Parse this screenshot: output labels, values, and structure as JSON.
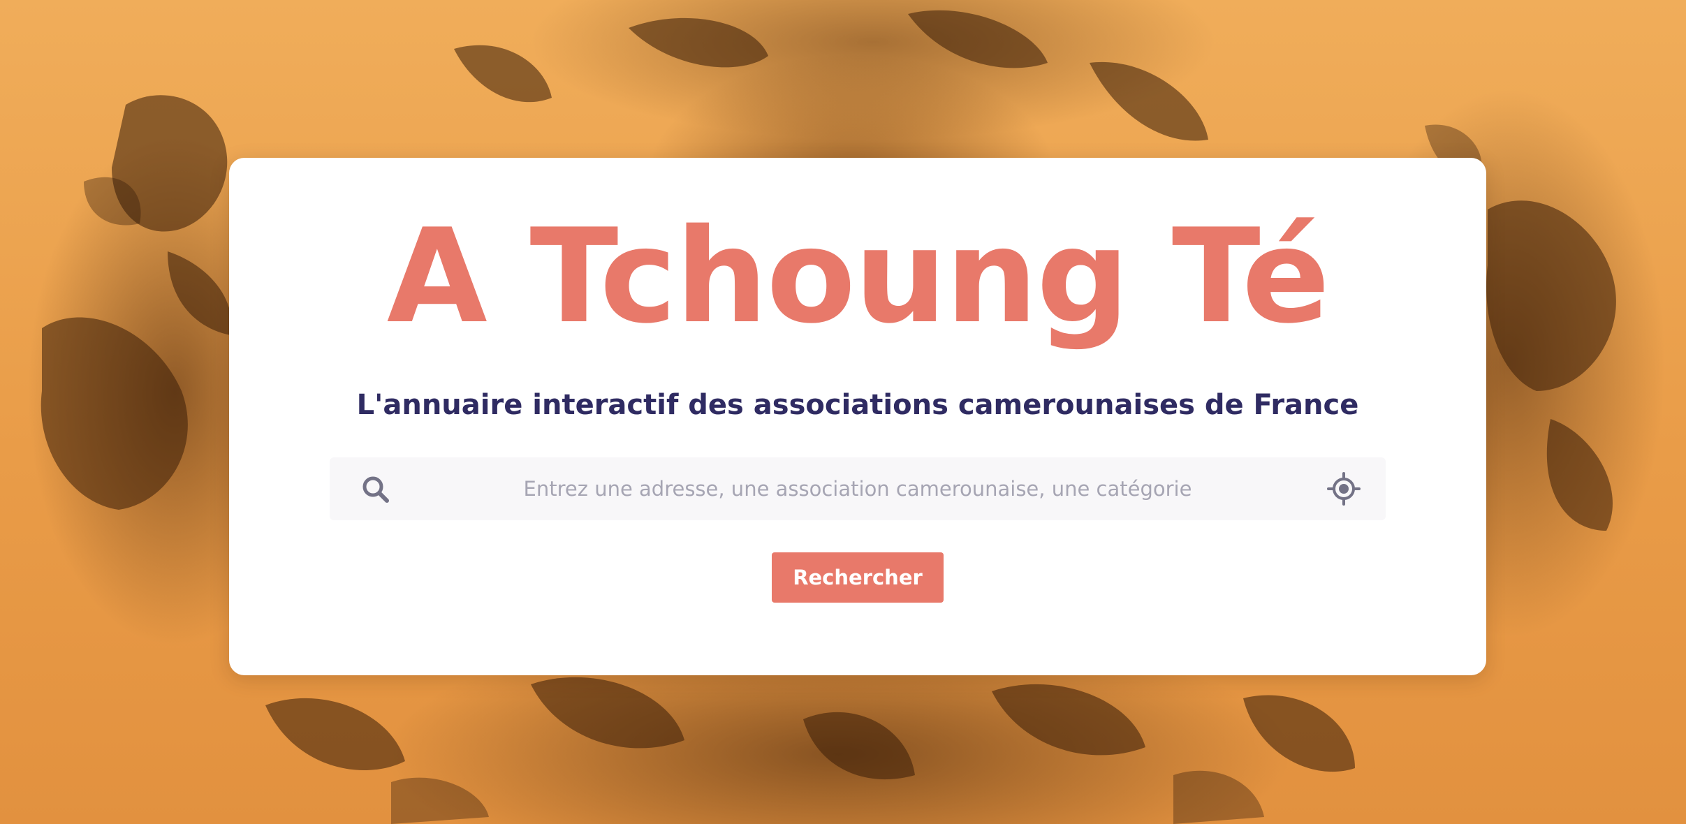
{
  "hero": {
    "title": "A Tchoung Té",
    "tagline": "L'annuaire interactif des associations camerounaises de France",
    "background_description_colors": {
      "base": "#e9a24e",
      "shadow": "#5a2d0a"
    }
  },
  "search": {
    "placeholder": "Entrez une adresse, une association camerounaise, une catégorie",
    "value": "",
    "leading_icon": "search-icon",
    "trailing_icon": "crosshair-locate-icon"
  },
  "actions": {
    "submit_label": "Rechercher"
  },
  "colors": {
    "accent": "#e8796a",
    "heading": "#2f2b62",
    "input_bg": "#f8f7f9",
    "placeholder": "#a6a5b3",
    "icon": "#737286"
  }
}
